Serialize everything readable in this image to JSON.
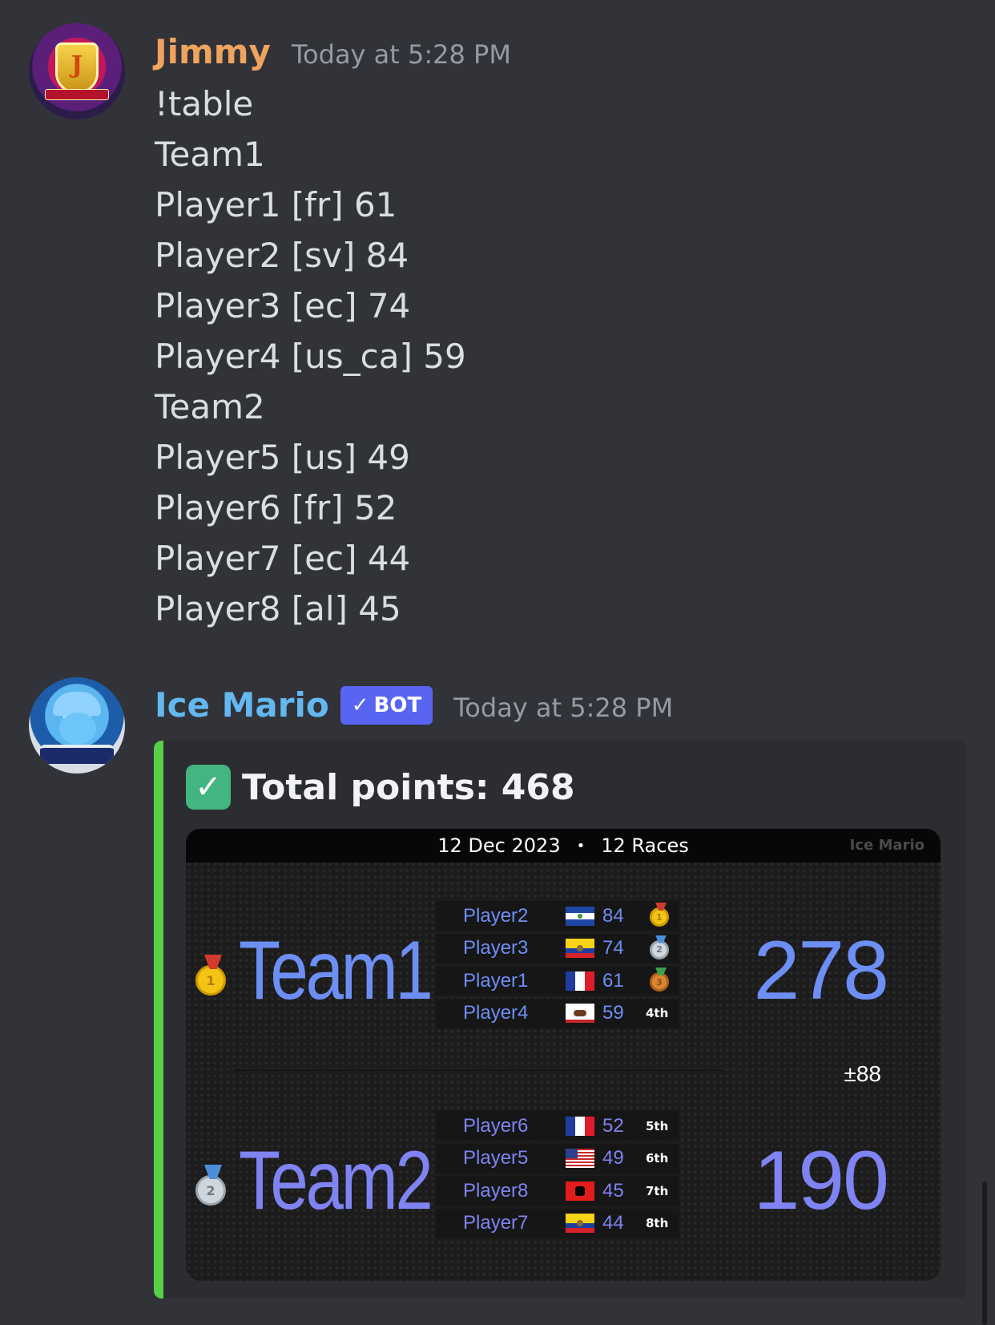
{
  "messages": [
    {
      "author": "Jimmy",
      "author_color": "#f0a35e",
      "timestamp": "Today at 5:28 PM",
      "avatar_icon": "jimmy-crest-avatar",
      "avatar_letter": "J",
      "lines": [
        "!table",
        "Team1",
        "Player1 [fr] 61",
        "Player2 [sv] 84",
        "Player3 [ec] 74",
        "Player4 [us_ca] 59",
        "Team2",
        "Player5 [us] 49",
        "Player6 [fr] 52",
        "Player7 [ec] 44",
        "Player8 [al] 45"
      ]
    },
    {
      "author": "Ice Mario",
      "author_color": "#63b8f0",
      "bot_tag": "BOT",
      "bot_check": "✓",
      "timestamp": "Today at 5:28 PM",
      "avatar_icon": "ice-mario-avatar"
    }
  ],
  "embed": {
    "accent_color": "#57d047",
    "title": "Total points: 468",
    "title_icon": "check-mark-icon",
    "card": {
      "date": "12 Dec 2023",
      "separator": "•",
      "races": "12 Races",
      "brand": "Ice Mario",
      "difference": "±88",
      "teams": [
        {
          "name": "Team1",
          "score": "278",
          "medal": "gold",
          "medal_num": "1",
          "color": "#6d8ff4",
          "players": [
            {
              "name": "Player2",
              "flag": "sv",
              "score": "84",
              "place": "",
              "medal": "gold",
              "medal_num": "1"
            },
            {
              "name": "Player3",
              "flag": "ec",
              "score": "74",
              "place": "",
              "medal": "silver",
              "medal_num": "2"
            },
            {
              "name": "Player1",
              "flag": "fr",
              "score": "61",
              "place": "",
              "medal": "bronze",
              "medal_num": "3"
            },
            {
              "name": "Player4",
              "flag": "us_ca",
              "score": "59",
              "place": "4th",
              "medal": "",
              "medal_num": ""
            }
          ]
        },
        {
          "name": "Team2",
          "score": "190",
          "medal": "silver",
          "medal_num": "2",
          "color": "#7f84f2",
          "players": [
            {
              "name": "Player6",
              "flag": "fr",
              "score": "52",
              "place": "5th",
              "medal": "",
              "medal_num": ""
            },
            {
              "name": "Player5",
              "flag": "us",
              "score": "49",
              "place": "6th",
              "medal": "",
              "medal_num": ""
            },
            {
              "name": "Player8",
              "flag": "al",
              "score": "45",
              "place": "7th",
              "medal": "",
              "medal_num": ""
            },
            {
              "name": "Player7",
              "flag": "ec",
              "score": "44",
              "place": "8th",
              "medal": "",
              "medal_num": ""
            }
          ]
        }
      ]
    }
  }
}
